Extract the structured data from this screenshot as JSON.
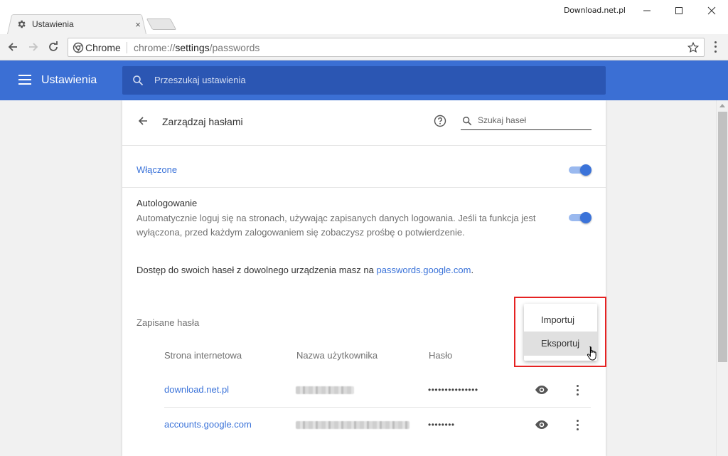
{
  "window": {
    "tab_title": "Ustawienia",
    "tab_close": "×",
    "watermark": "Download.net.pl"
  },
  "address_bar": {
    "chrome_label": "Chrome",
    "url_scheme": "chrome://",
    "url_host": "settings",
    "url_path": "/passwords"
  },
  "settings_header": {
    "title": "Ustawienia",
    "search_placeholder": "Przeszukaj ustawienia"
  },
  "page": {
    "title": "Zarządzaj hasłami",
    "search_placeholder": "Szukaj haseł",
    "enabled_label": "Włączone",
    "enabled_on": true,
    "autologin_title": "Autologowanie",
    "autologin_desc": "Automatycznie loguj się na stronach, używając zapisanych danych logowania. Jeśli ta funkcja jest wyłączona, przed każdym zalogowaniem się zobaczysz prośbę o potwierdzenie.",
    "autologin_on": true,
    "access_text": "Dostęp do swoich haseł z dowolnego urządzenia masz na ",
    "access_link": "passwords.google.com",
    "access_suffix": ".",
    "saved_title": "Zapisane hasła"
  },
  "table": {
    "columns": [
      "Strona internetowa",
      "Nazwa użytkownika",
      "Hasło"
    ],
    "rows": [
      {
        "site": "download.net.pl",
        "password": "•••••••••••••••"
      },
      {
        "site": "accounts.google.com",
        "password": "••••••••"
      }
    ]
  },
  "popup_menu": {
    "items": [
      "Importuj",
      "Eksportuj"
    ],
    "hovered": "Eksportuj"
  },
  "colors": {
    "header_blue": "#3b6fd4",
    "search_blue": "#2b56b3",
    "link_blue": "#3b73d9",
    "highlight_red": "#e52222"
  }
}
